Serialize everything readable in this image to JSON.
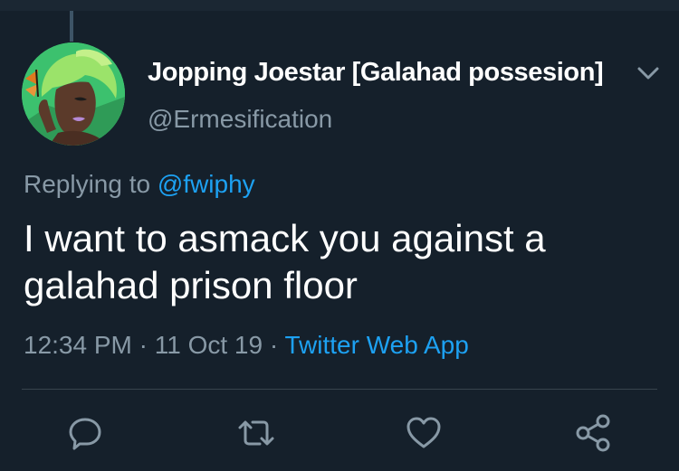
{
  "tweet": {
    "author": {
      "display_name": "Jopping Joestar [Galahad possesion]",
      "handle": "@Ermesification",
      "avatar_icon": "profile-avatar"
    },
    "reply": {
      "prefix": "Replying to ",
      "mention": "@fwiphy"
    },
    "text": "I want to asmack you against a galahad prison floor",
    "meta": {
      "time": "12:34 PM",
      "separator": " · ",
      "date": "11 Oct 19",
      "source": "Twitter Web App"
    },
    "actions": [
      {
        "icon": "reply-icon"
      },
      {
        "icon": "retweet-icon"
      },
      {
        "icon": "like-icon"
      },
      {
        "icon": "share-icon"
      }
    ]
  },
  "colors": {
    "background": "#15202b",
    "primary_text": "#ffffff",
    "secondary_text": "#8899a6",
    "accent": "#1da1f2",
    "divider": "#38444d"
  }
}
